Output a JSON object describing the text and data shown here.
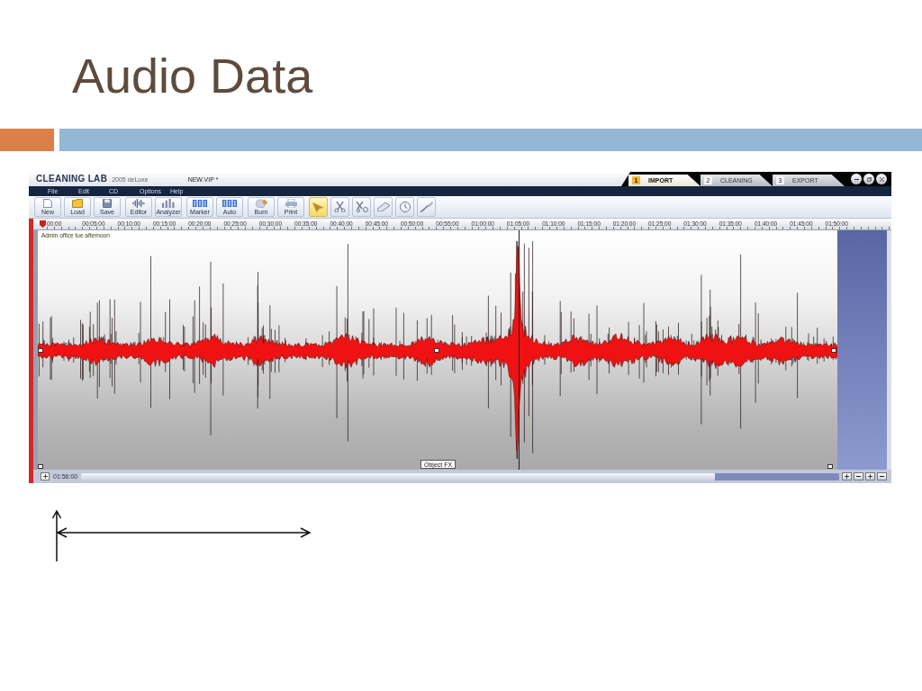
{
  "slide": {
    "title": "Audio Data"
  },
  "app": {
    "product": "CLEANING LAB",
    "edition": "2005 deLuxe",
    "document": "NEW.VIP *",
    "steps": [
      {
        "number": "1",
        "label": "IMPORT",
        "selected": true
      },
      {
        "number": "2",
        "label": "CLEANING",
        "selected": false
      },
      {
        "number": "3",
        "label": "EXPORT",
        "selected": false
      }
    ],
    "menu": [
      "File",
      "Edit",
      "CD",
      "Options",
      "Help"
    ],
    "toolbar_groups": [
      {
        "buttons": [
          {
            "label": "New"
          },
          {
            "label": "Load"
          },
          {
            "label": "Save"
          }
        ]
      },
      {
        "buttons": [
          {
            "label": "Editor"
          },
          {
            "label": "Analyzer"
          }
        ]
      },
      {
        "buttons": [
          {
            "label": "Marker"
          },
          {
            "label": "Auto"
          }
        ]
      },
      {
        "buttons": [
          {
            "label": "Burn"
          },
          {
            "label": "Print"
          }
        ]
      }
    ],
    "tools": [
      {
        "selected": true
      },
      {
        "selected": false
      },
      {
        "selected": false
      },
      {
        "selected": false
      },
      {
        "selected": false
      },
      {
        "selected": false
      }
    ],
    "ruler": [
      "00:00",
      "00:05:00",
      "00:10:00",
      "00:15:00",
      "00:20:00",
      "00:25:00",
      "00:30:00",
      "00:35:00",
      "00:40:00",
      "00:45:00",
      "00:50:00",
      "00:55:00",
      "01:00:00",
      "01:05:00",
      "01:10:00",
      "01:15:00",
      "01:20:00",
      "01:25:00",
      "01:30:00",
      "01:35:00",
      "01:40:00",
      "01:45:00",
      "01:50:00"
    ],
    "track": {
      "name": "Admin office tue afternoon"
    },
    "object_fx": "Object FX",
    "position": "01:56:00"
  }
}
